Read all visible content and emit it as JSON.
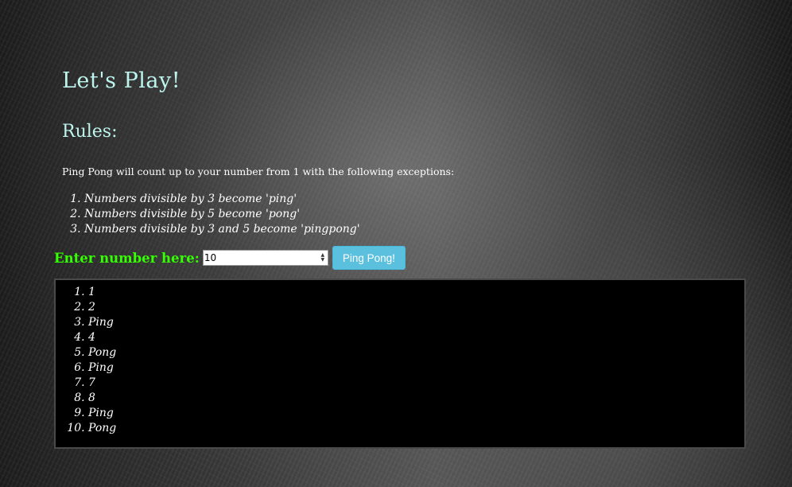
{
  "page": {
    "title": "Let's Play!",
    "rules_heading": "Rules:",
    "intro": "Ping Pong will count up to your number from 1 with the following exceptions:",
    "rules": [
      "Numbers divisible by 3 become 'ping'",
      "Numbers divisible by 5 become 'pong'",
      "Numbers divisible by 3 and 5 become 'pingpong'"
    ]
  },
  "form": {
    "label": "Enter number here:",
    "input_value": "10",
    "button_label": "Ping Pong!"
  },
  "results": [
    "1",
    "2",
    "Ping",
    "4",
    "Pong",
    "Ping",
    "7",
    "8",
    "Ping",
    "Pong"
  ],
  "colors": {
    "heading": "#bdf5ee",
    "label": "#33ff00",
    "button": "#5bc0de",
    "results_bg": "#000000"
  },
  "icons": {
    "spinner_up": "spinner-up-icon",
    "spinner_down": "spinner-down-icon"
  }
}
